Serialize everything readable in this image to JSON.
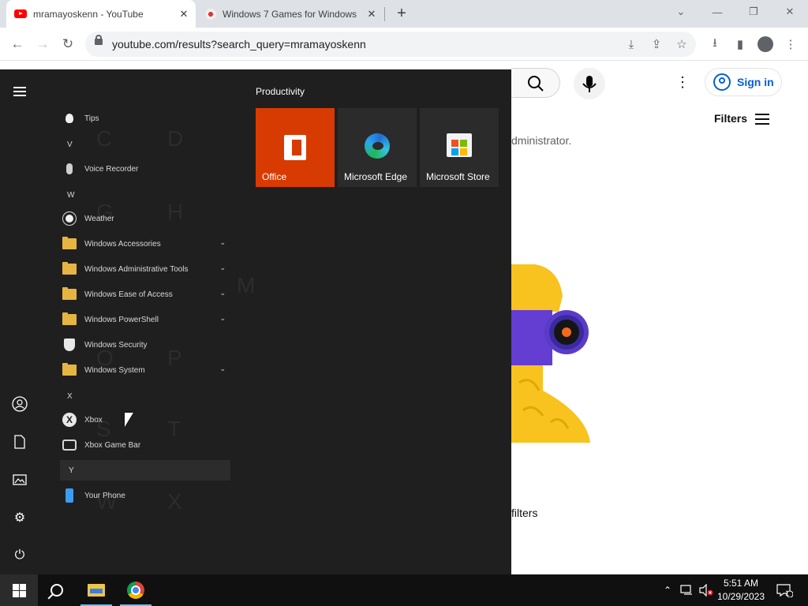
{
  "browser": {
    "tabs": [
      {
        "title": "mramayoskenn - YouTube",
        "active": true,
        "icon": "youtube-favicon"
      },
      {
        "title": "Windows 7 Games for Windows",
        "active": false,
        "icon": "games-favicon"
      }
    ],
    "url": "youtube.com/results?search_query=mramayoskenn",
    "window_controls": {
      "minimize": "—",
      "restore": "❐",
      "close": "✕",
      "tab_search": "⌄"
    }
  },
  "youtube": {
    "sign_in": "Sign in",
    "filters": "Filters",
    "message_partial": "dministrator.",
    "filters_message_partial": "filters",
    "colors": {
      "link": "#065fd4",
      "illustration_yellow": "#f8c21f",
      "illustration_purple": "#5a3bc8"
    }
  },
  "start_menu": {
    "tiles_group": "Productivity",
    "tiles": [
      {
        "label": "Office",
        "color": "#d83b01",
        "icon": "office-icon"
      },
      {
        "label": "Microsoft Edge",
        "color": "#2b2b2b",
        "icon": "edge-icon"
      },
      {
        "label": "Microsoft Store",
        "color": "#2b2b2b",
        "icon": "store-icon"
      }
    ],
    "apps": {
      "tips": "Tips",
      "letter_v": "V",
      "voice_recorder": "Voice Recorder",
      "letter_w": "W",
      "weather": "Weather",
      "win_accessories": "Windows Accessories",
      "win_admin_tools": "Windows Administrative Tools",
      "win_ease": "Windows Ease of Access",
      "win_powershell": "Windows PowerShell",
      "win_security": "Windows Security",
      "win_system": "Windows System",
      "letter_x": "X",
      "xbox": "Xbox",
      "xbox_game_bar": "Xbox Game Bar",
      "letter_y": "Y",
      "your_phone": "Your Phone"
    }
  },
  "taskbar": {
    "time": "5:51 AM",
    "date": "10/29/2023",
    "notification_count": "1"
  }
}
